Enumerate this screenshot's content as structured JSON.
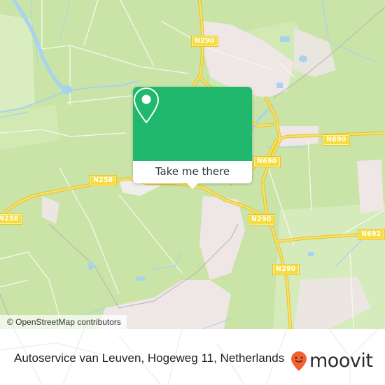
{
  "map": {
    "road_labels": [
      {
        "id": "n290-top",
        "text": "N290"
      },
      {
        "id": "n690-right",
        "text": "N690"
      },
      {
        "id": "n690-center",
        "text": "N690"
      },
      {
        "id": "n258-center",
        "text": "N258"
      },
      {
        "id": "n258-left",
        "text": "N258"
      },
      {
        "id": "n290-mid",
        "text": "N290"
      },
      {
        "id": "n692",
        "text": "N692"
      },
      {
        "id": "n290-bottom",
        "text": "N290"
      }
    ],
    "colors": {
      "land": "#c9e4a6",
      "urban": "#efe6e6",
      "water": "#a8d2ee",
      "road": "#f6dc3c"
    },
    "attribution": "© OpenStreetMap contributors"
  },
  "popup": {
    "icon": "location-pin-icon",
    "button_label": "Take me there",
    "accent_color": "#1fb86c"
  },
  "footer": {
    "address": "Autoservice van Leuven, Hogeweg 11, Netherlands",
    "brand": {
      "name": "moovit",
      "icon": "moovit-pin-logo-icon",
      "color": "#f2622e"
    }
  }
}
